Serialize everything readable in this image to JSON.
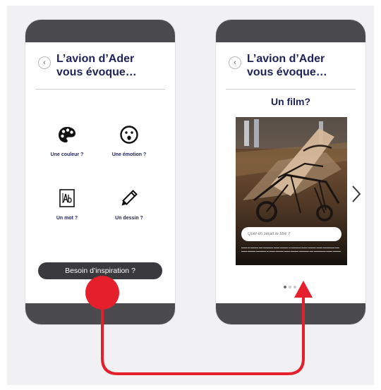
{
  "colors": {
    "accent": "#e51f2b",
    "navy": "#1f2257",
    "phone_bar": "#4b4b4f",
    "button_dark": "#3a3a3e"
  },
  "screen_left": {
    "title_line1": "L’avion d’Ader",
    "title_line2": "vous évoque…",
    "options": [
      {
        "label": "Une couleur ?",
        "icon": "palette-icon"
      },
      {
        "label": "Une émotion ?",
        "icon": "surprised-face-icon"
      },
      {
        "label": "Un mot ?",
        "icon": "text-abc-icon"
      },
      {
        "label": "Un dessin ?",
        "icon": "pencil-icon"
      }
    ],
    "inspiration_button": "Besoin d’inspiration ?"
  },
  "screen_right": {
    "title_line1": "L’avion d’Ader",
    "title_line2": "vous évoque…",
    "subtitle": "Un film?",
    "input_placeholder": "Quel en serait le titre ?",
    "pagination": {
      "total": 3,
      "active": 1
    }
  }
}
